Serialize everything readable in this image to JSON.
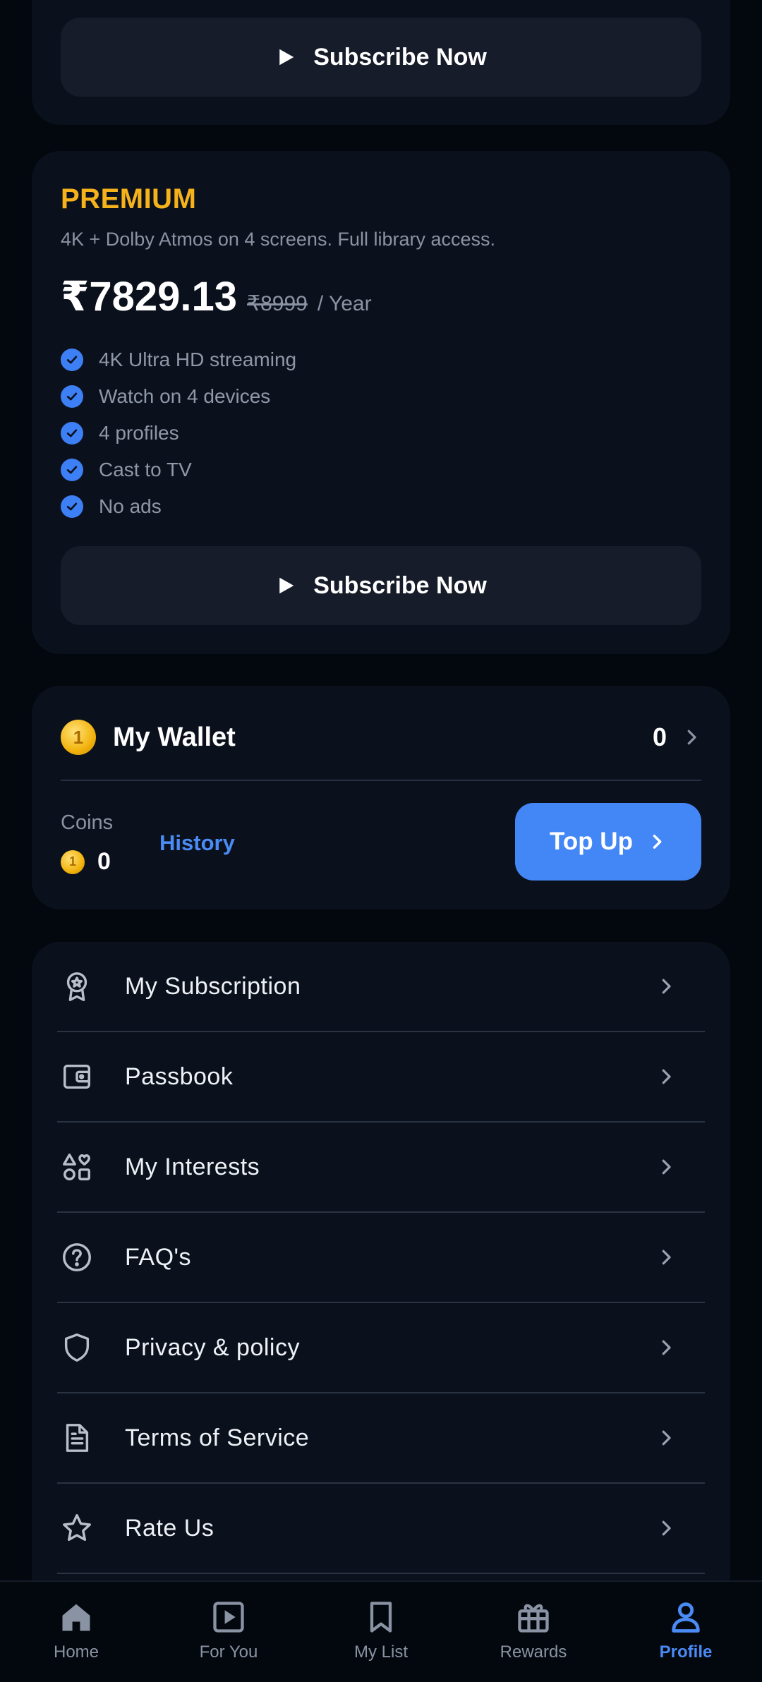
{
  "top_card": {
    "subscribe_label": "Subscribe Now"
  },
  "premium": {
    "name": "PREMIUM",
    "description": "4K + Dolby Atmos on 4 screens. Full library access.",
    "price": "₹7829.13",
    "original_price": "₹8999",
    "period": "/ Year",
    "features": [
      "4K Ultra HD streaming",
      "Watch on 4 devices",
      "4 profiles",
      "Cast to TV",
      "No ads"
    ],
    "subscribe_label": "Subscribe Now",
    "accent_color": "#f5b21b"
  },
  "wallet": {
    "title": "My Wallet",
    "balance": "0",
    "coins_label": "Coins",
    "coins_value": "0",
    "history_label": "History",
    "topup_label": "Top Up",
    "coin_icon": "coin-icon"
  },
  "menu": [
    {
      "label": "My Subscription",
      "icon": "award-icon"
    },
    {
      "label": "Passbook",
      "icon": "wallet-icon"
    },
    {
      "label": "My Interests",
      "icon": "interests-icon"
    },
    {
      "label": "FAQ's",
      "icon": "help-circle-icon"
    },
    {
      "label": "Privacy & policy",
      "icon": "shield-icon"
    },
    {
      "label": "Terms of Service",
      "icon": "document-icon"
    },
    {
      "label": "Rate Us",
      "icon": "star-icon"
    }
  ],
  "bottom_nav": [
    {
      "label": "Home",
      "icon": "home-icon"
    },
    {
      "label": "For You",
      "icon": "play-square-icon"
    },
    {
      "label": "My List",
      "icon": "bookmark-icon"
    },
    {
      "label": "Rewards",
      "icon": "gift-icon"
    },
    {
      "label": "Profile",
      "icon": "user-icon",
      "active": true
    }
  ],
  "colors": {
    "accent": "#4387f6",
    "background": "#03070e",
    "card": "#0b111c"
  }
}
